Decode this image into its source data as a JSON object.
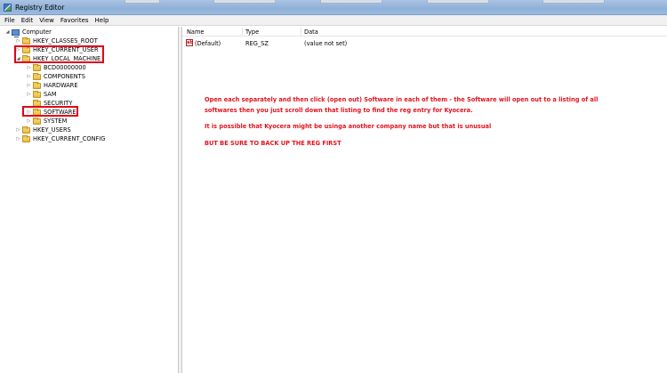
{
  "window": {
    "title": "Registry Editor"
  },
  "menu": [
    "File",
    "Edit",
    "View",
    "Favorites",
    "Help"
  ],
  "tree": {
    "root": "Computer",
    "hives": [
      "HKEY_CLASSES_ROOT",
      "HKEY_CURRENT_USER",
      "HKEY_LOCAL_MACHINE"
    ],
    "hklm_children": [
      "BCD00000000",
      "COMPONENTS",
      "HARDWARE",
      "SAM",
      "SECURITY",
      "SOFTWARE",
      "SYSTEM"
    ],
    "more_hives": [
      "HKEY_USERS",
      "HKEY_CURRENT_CONFIG"
    ]
  },
  "list": {
    "columns": [
      "Name",
      "Type",
      "Data"
    ],
    "rows": [
      {
        "name": "(Default)",
        "type": "REG_SZ",
        "data": "(value not set)"
      }
    ]
  },
  "annotation": {
    "line1": "Open each separately and then click (open out) Software in each of them - the Software will open out to a listing of all",
    "line2": "softwares  then you just scroll down that listing to find the reg entry for Kyocera.",
    "line3": "It is possible that Kyocera might be usinga another company name but that is unusual",
    "line4": "BUT BE SURE TO BACK UP THE REG FIRST",
    "color": "#e0141e"
  },
  "colors": {
    "highlight_box": "#e0001a",
    "titlebar": "#9bbbe0"
  }
}
